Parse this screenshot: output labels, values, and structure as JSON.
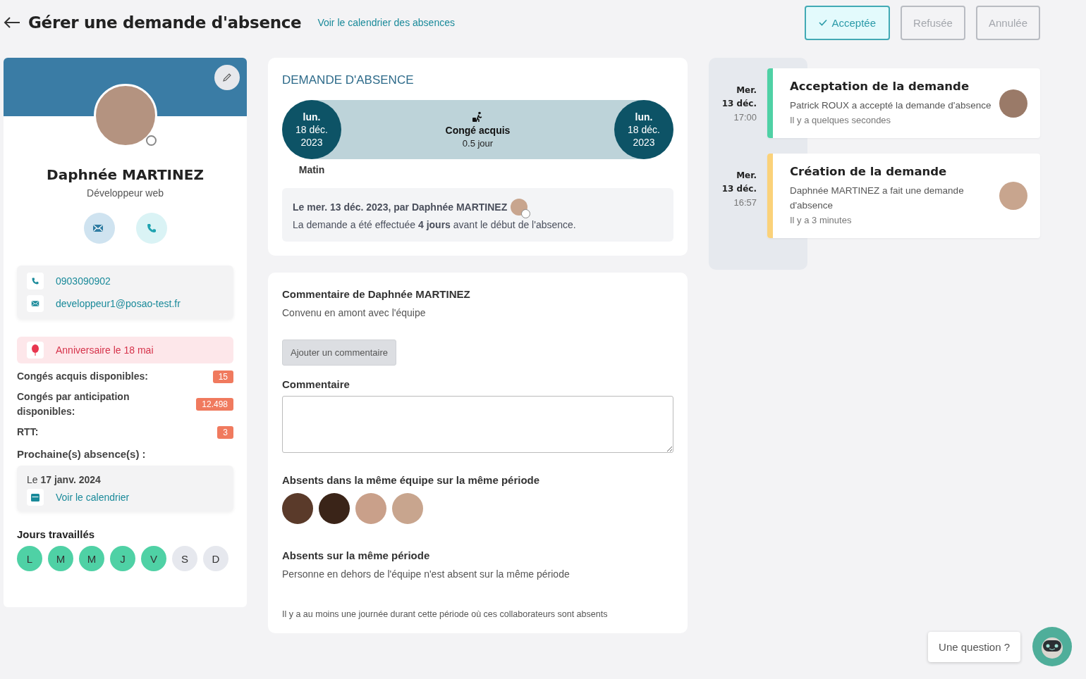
{
  "header": {
    "title": "Gérer une demande d'absence",
    "calendar_link": "Voir le calendrier des absences",
    "statuses": [
      {
        "label": "Acceptée",
        "selected": true
      },
      {
        "label": "Refusée",
        "selected": false
      },
      {
        "label": "Annulée",
        "selected": false
      }
    ]
  },
  "profile": {
    "name": "Daphnée MARTINEZ",
    "job": "Développeur web",
    "phone": "0903090902",
    "email": "developpeur1@posao-test.fr",
    "birthday": "Anniversaire le 18 mai",
    "balances": [
      {
        "label": "Congés acquis disponibles:",
        "value": "15"
      },
      {
        "label": "Congés par anticipation disponibles:",
        "value": "12.498"
      },
      {
        "label": "RTT:",
        "value": "3"
      }
    ],
    "next_absences_label": "Prochaine(s) absence(s) :",
    "next_absence": "Le **17 janv. 2024**",
    "calendar_link": "Voir le calendrier",
    "workdays_label": "Jours travaillés",
    "workdays": [
      {
        "label": "L",
        "selected": true
      },
      {
        "label": "M",
        "selected": true
      },
      {
        "label": "M",
        "selected": true
      },
      {
        "label": "J",
        "selected": true
      },
      {
        "label": "V",
        "selected": true
      },
      {
        "label": "S",
        "selected": false
      },
      {
        "label": "D",
        "selected": false
      }
    ]
  },
  "request": {
    "title": "DEMANDE D'ABSENCE",
    "start": {
      "day": "lun.",
      "date": "18 déc.",
      "year": "2023"
    },
    "end": {
      "day": "lun.",
      "date": "18 déc.",
      "year": "2023"
    },
    "type": "Congé acquis",
    "duration": "0.5 jour",
    "period": "Matin",
    "submitted": "Le mer. 13 déc. 2023, par Daphnée MARTINEZ",
    "notice": "La demande a été effectuée **4 jours** avant le début de l'absence."
  },
  "comments": {
    "title": "Commentaire de Daphnée MARTINEZ",
    "text": "Convenu en amont avec l'équipe",
    "add_button": "Ajouter un commentaire",
    "field_label": "Commentaire",
    "team_absent_title": "Absents dans la même équipe sur la même période",
    "others_title": "Absents sur la même période",
    "others_text": "Personne en dehors de l'équipe n'est absent sur la même période",
    "footnote": "Il y a au moins une journée durant cette période où ces collaborateurs sont absents"
  },
  "timeline": [
    {
      "day": "Mer.",
      "date": "13 déc.",
      "time": "17:00",
      "title": "Acceptation de la demande",
      "text": "Patrick ROUX a accepté la demande d'absence",
      "ago": "Il y a quelques secondes",
      "color": "#4fd1a5"
    },
    {
      "day": "Mer.",
      "date": "13 déc.",
      "time": "16:57",
      "title": "Création de la demande",
      "text": "Daphnée MARTINEZ a fait une demande d'absence",
      "ago": "Il y a 3 minutes",
      "color": "#fbd27a"
    }
  ],
  "help": {
    "label": "Une question ?"
  }
}
